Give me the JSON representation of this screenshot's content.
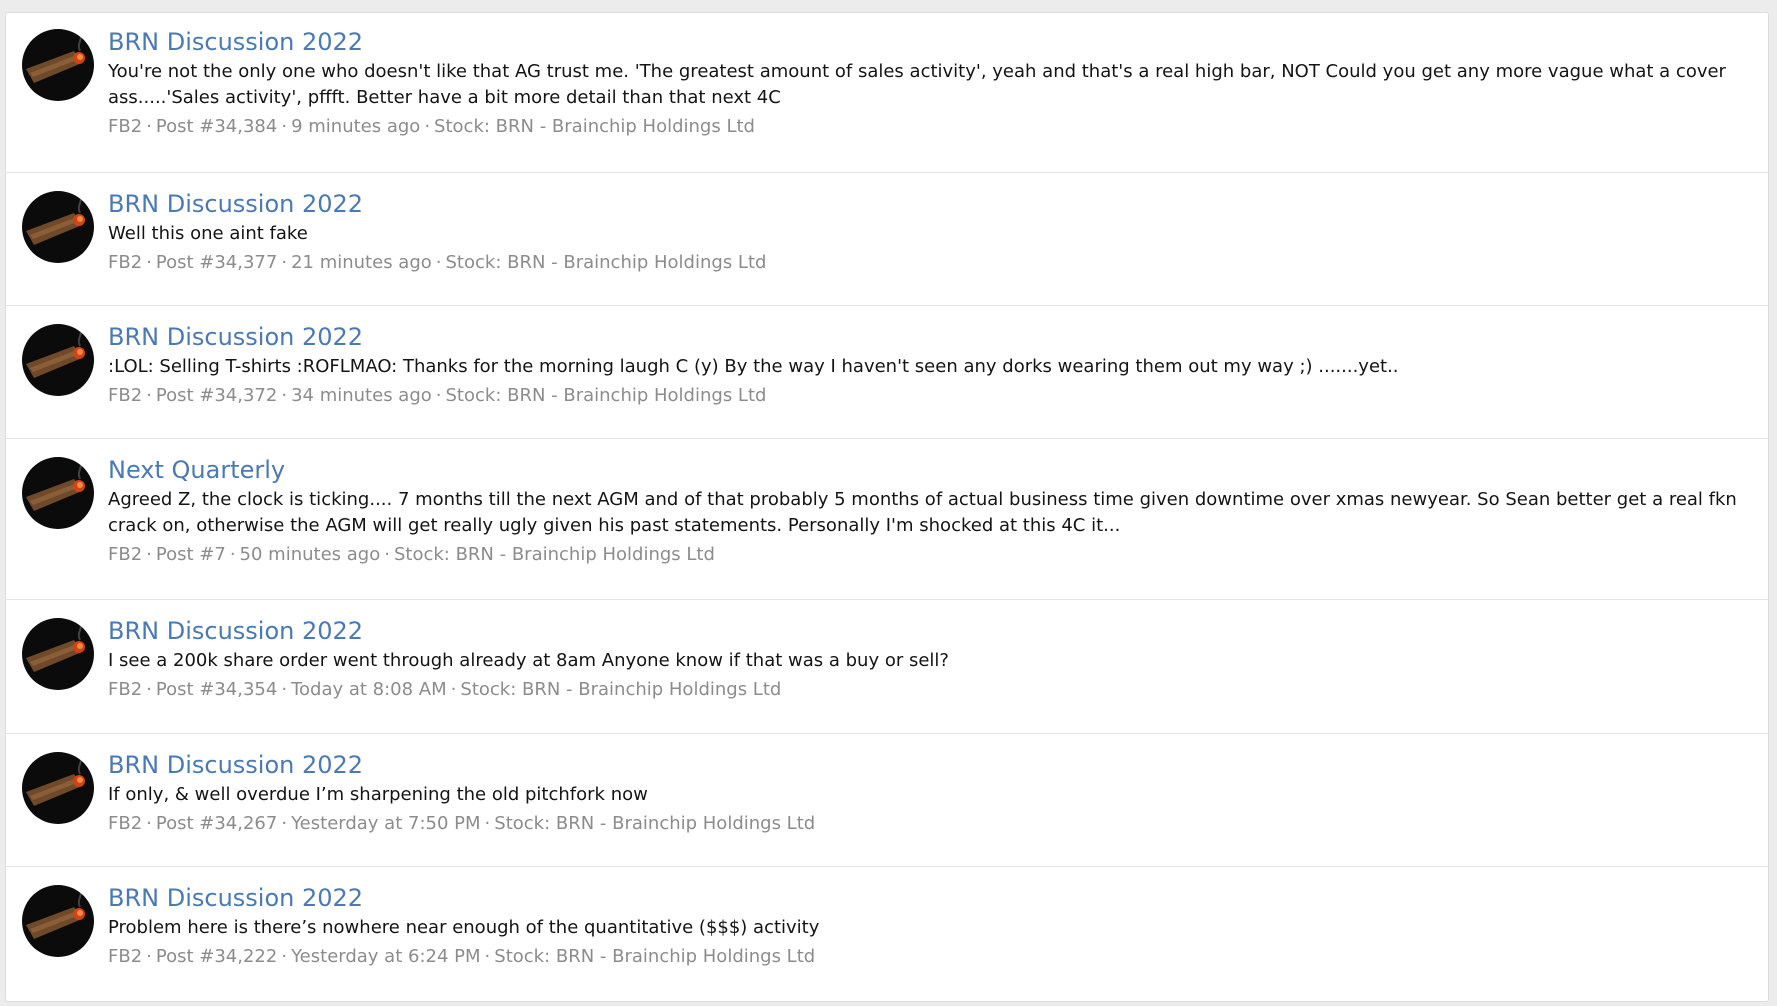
{
  "results": [
    {
      "title": "BRN Discussion 2022",
      "snippet": "You're not the only one who doesn't like that AG trust me. 'The greatest amount of sales activity', yeah and that's a real high bar, NOT Could you get any more vague what a cover ass.....'Sales activity', pffft. Better have a bit more detail than that next 4C",
      "user": "FB2",
      "post": "Post #34,384",
      "time": "9 minutes ago",
      "stock": "Stock: BRN - Brainchip Holdings Ltd"
    },
    {
      "title": "BRN Discussion 2022",
      "snippet": "Well this one aint fake",
      "user": "FB2",
      "post": "Post #34,377",
      "time": "21 minutes ago",
      "stock": "Stock: BRN - Brainchip Holdings Ltd"
    },
    {
      "title": "BRN Discussion 2022",
      "snippet": ":LOL: Selling T-shirts :ROFLMAO: Thanks for the morning laugh C (y) By the way I haven't seen any dorks wearing them out my way ;) .......yet..",
      "user": "FB2",
      "post": "Post #34,372",
      "time": "34 minutes ago",
      "stock": "Stock: BRN - Brainchip Holdings Ltd"
    },
    {
      "title": "Next Quarterly",
      "snippet": "Agreed Z, the clock is ticking.... 7 months till the next AGM and of that probably 5 months of actual business time given downtime over xmas newyear. So Sean better get a real fkn crack on, otherwise the AGM will get really ugly given his past statements. Personally I'm shocked at this 4C it...",
      "user": "FB2",
      "post": "Post #7",
      "time": "50 minutes ago",
      "stock": "Stock: BRN - Brainchip Holdings Ltd"
    },
    {
      "title": "BRN Discussion 2022",
      "snippet": "I see a 200k share order went through already at 8am Anyone know if that was a buy or sell?",
      "user": "FB2",
      "post": "Post #34,354",
      "time": "Today at 8:08 AM",
      "stock": "Stock: BRN - Brainchip Holdings Ltd"
    },
    {
      "title": "BRN Discussion 2022",
      "snippet": "If only, & well overdue I’m sharpening the old pitchfork now",
      "user": "FB2",
      "post": "Post #34,267",
      "time": "Yesterday at 7:50 PM",
      "stock": "Stock: BRN - Brainchip Holdings Ltd"
    },
    {
      "title": "BRN Discussion 2022",
      "snippet": "Problem here is there’s nowhere near enough of the quantitative ($$$) activity",
      "user": "FB2",
      "post": "Post #34,222",
      "time": "Yesterday at 6:24 PM",
      "stock": "Stock: BRN - Brainchip Holdings Ltd"
    }
  ],
  "separator": "·",
  "colors": {
    "title_link": "#4a79b4",
    "snippet_text": "#141414",
    "meta_text": "#8c8c8c",
    "divider": "#e3e3e3",
    "page_background": "#ececec"
  },
  "avatar_icon": "cigar-avatar-icon"
}
